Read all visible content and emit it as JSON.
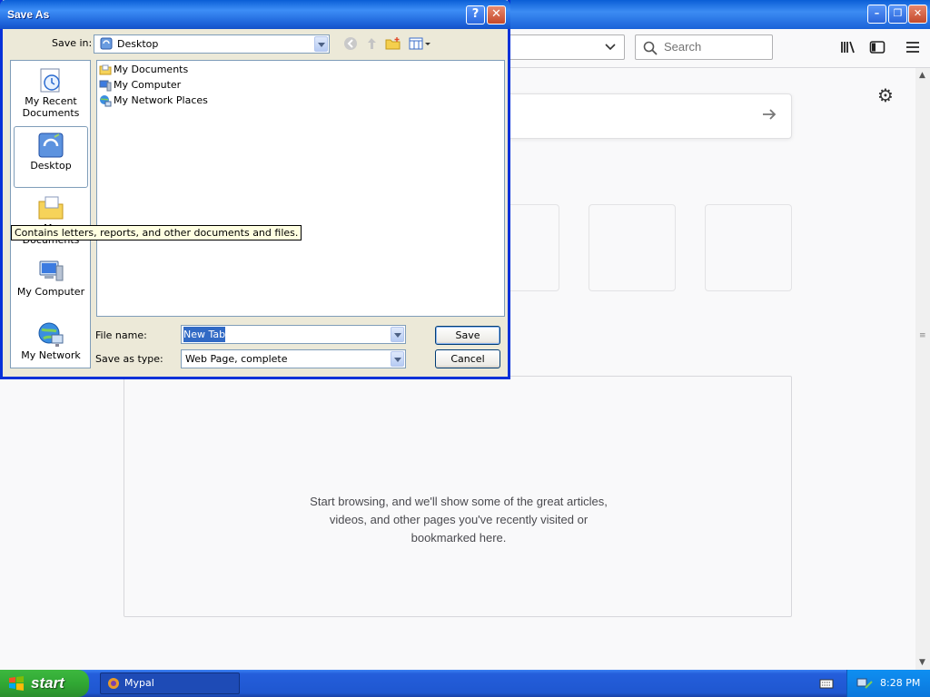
{
  "browser": {
    "search_placeholder": "Search",
    "highlights_message": "Start browsing, and we'll show some of the great articles, videos, and other pages you've recently visited or bookmarked here.",
    "icons": [
      "library-icon",
      "sidebar-icon",
      "menu-icon",
      "gear-icon",
      "arrow-right-icon",
      "search-icon"
    ]
  },
  "dialog": {
    "title": "Save As",
    "help_label": "?",
    "close_label": "✕",
    "save_in_label": "Save in:",
    "save_in_value": "Desktop",
    "places": [
      {
        "label": "My Recent Documents"
      },
      {
        "label": "Desktop"
      },
      {
        "label": "My Documents"
      },
      {
        "label": "My Computer"
      },
      {
        "label": "My Network"
      }
    ],
    "files": [
      {
        "name": "My Documents"
      },
      {
        "name": "My Computer"
      },
      {
        "name": "My Network Places"
      }
    ],
    "file_name_label": "File name:",
    "file_name_value": "New Tab",
    "save_type_label": "Save as type:",
    "save_type_value": "Web Page, complete",
    "save_button": "Save",
    "cancel_button": "Cancel",
    "tooltip": "Contains letters, reports, and other documents and files."
  },
  "taskbar": {
    "start_label": "start",
    "task_item": "Mypal",
    "clock": "8:28 PM"
  }
}
